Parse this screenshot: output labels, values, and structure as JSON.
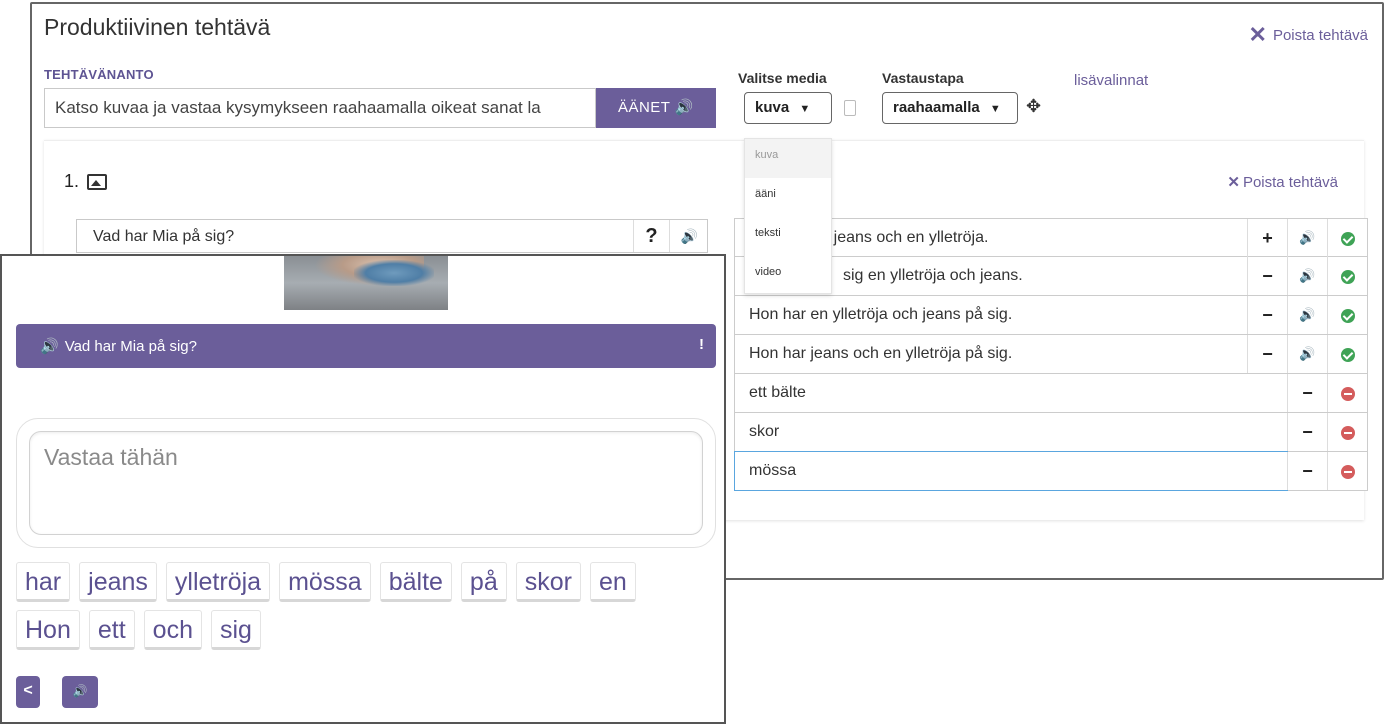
{
  "editor": {
    "title": "Produktiivinen tehtävä",
    "remove_task": "Poista tehtävä",
    "instructions_label": "TEHTÄVÄNANTO",
    "instructions_value": "Katso kuvaa ja vastaa kysymykseen raahaamalla oikeat sanat la",
    "voices_button": "ÄÄNET",
    "media_label": "Valitse media",
    "media_selected": "kuva",
    "media_options": [
      "kuva",
      "ääni",
      "teksti",
      "video"
    ],
    "answer_method_label": "Vastaustapa",
    "answer_method_selected": "raahaamalla",
    "more_options": "lisävalinnat"
  },
  "question_card": {
    "number": "1.",
    "remove_task": "Poista tehtävä",
    "question_text": "Vad har Mia på sig?",
    "help_symbol": "?",
    "answers": [
      {
        "text": ") sig jeans och en ylletröja.",
        "action": "+",
        "status": "correct"
      },
      {
        "text": "sig en ylletröja och jeans.",
        "action": "−",
        "status": "correct"
      },
      {
        "text": "Hon har en ylletröja och jeans på sig.",
        "action": "−",
        "status": "correct"
      },
      {
        "text": "Hon har jeans och en ylletröja på sig.",
        "action": "−",
        "status": "correct"
      },
      {
        "text": "ett bälte",
        "action": "−",
        "status": "wrong"
      },
      {
        "text": "skor",
        "action": "−",
        "status": "wrong"
      },
      {
        "text": "mössa",
        "action": "−",
        "status": "wrong"
      }
    ]
  },
  "preview": {
    "question_text": "Vad har Mia på sig?",
    "exclamation": "!",
    "answer_placeholder": "Vastaa tähän",
    "word_chips_row1": [
      "har",
      "jeans",
      "ylletröja",
      "mössa",
      "bälte",
      "på",
      "skor",
      "en"
    ],
    "word_chips_row2": [
      "Hon",
      "ett",
      "och",
      "sig"
    ],
    "back_symbol": "<"
  },
  "colors": {
    "accent": "#6b5e9a",
    "correct": "#3fa356",
    "wrong": "#d45c5c",
    "focus": "#5aa6df"
  }
}
